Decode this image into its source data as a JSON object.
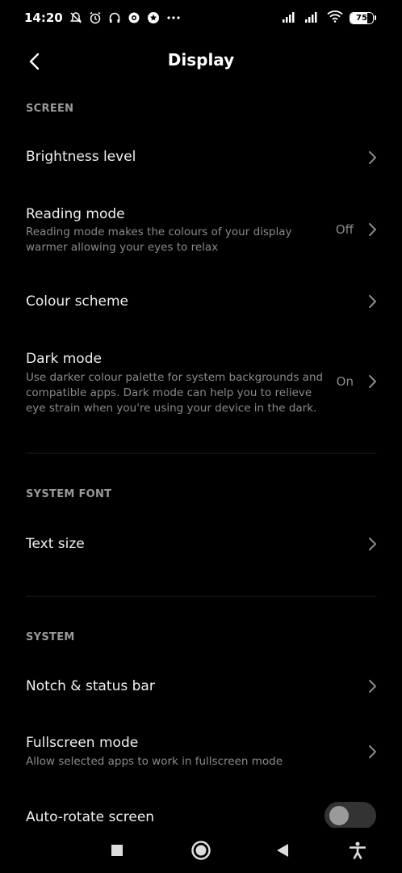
{
  "status_bar": {
    "time": "14:20",
    "battery": "75",
    "battery_level": 0.75
  },
  "header": {
    "title": "Display"
  },
  "sections": {
    "screen": {
      "label": "SCREEN",
      "brightness": {
        "title": "Brightness level"
      },
      "reading_mode": {
        "title": "Reading mode",
        "subtitle_line1": "Reading mode makes the colours of your display",
        "subtitle_line2": "warmer allowing your eyes to relax",
        "value": "Off"
      },
      "colour_scheme": {
        "title": "Colour scheme"
      },
      "dark_mode": {
        "title": "Dark mode",
        "subtitle_line1": "Use darker colour palette for system backgrounds and",
        "subtitle_line2": "compatible apps. Dark mode can help you to relieve",
        "subtitle_line3": "eye strain when you're using your device in the dark.",
        "value": "On"
      }
    },
    "system_font": {
      "label": "SYSTEM FONT",
      "text_size": {
        "title": "Text size"
      }
    },
    "system": {
      "label": "SYSTEM",
      "notch": {
        "title": "Notch & status bar"
      },
      "fullscreen": {
        "title": "Fullscreen mode",
        "subtitle": "Allow selected apps to work in fullscreen mode"
      },
      "auto_rotate": {
        "title": "Auto-rotate screen",
        "enabled": false
      }
    }
  },
  "colors": {
    "background": "#000000",
    "text_primary": "#f0f0f0",
    "text_secondary": "#8a8a8a",
    "section_header": "#9a9a9a"
  }
}
